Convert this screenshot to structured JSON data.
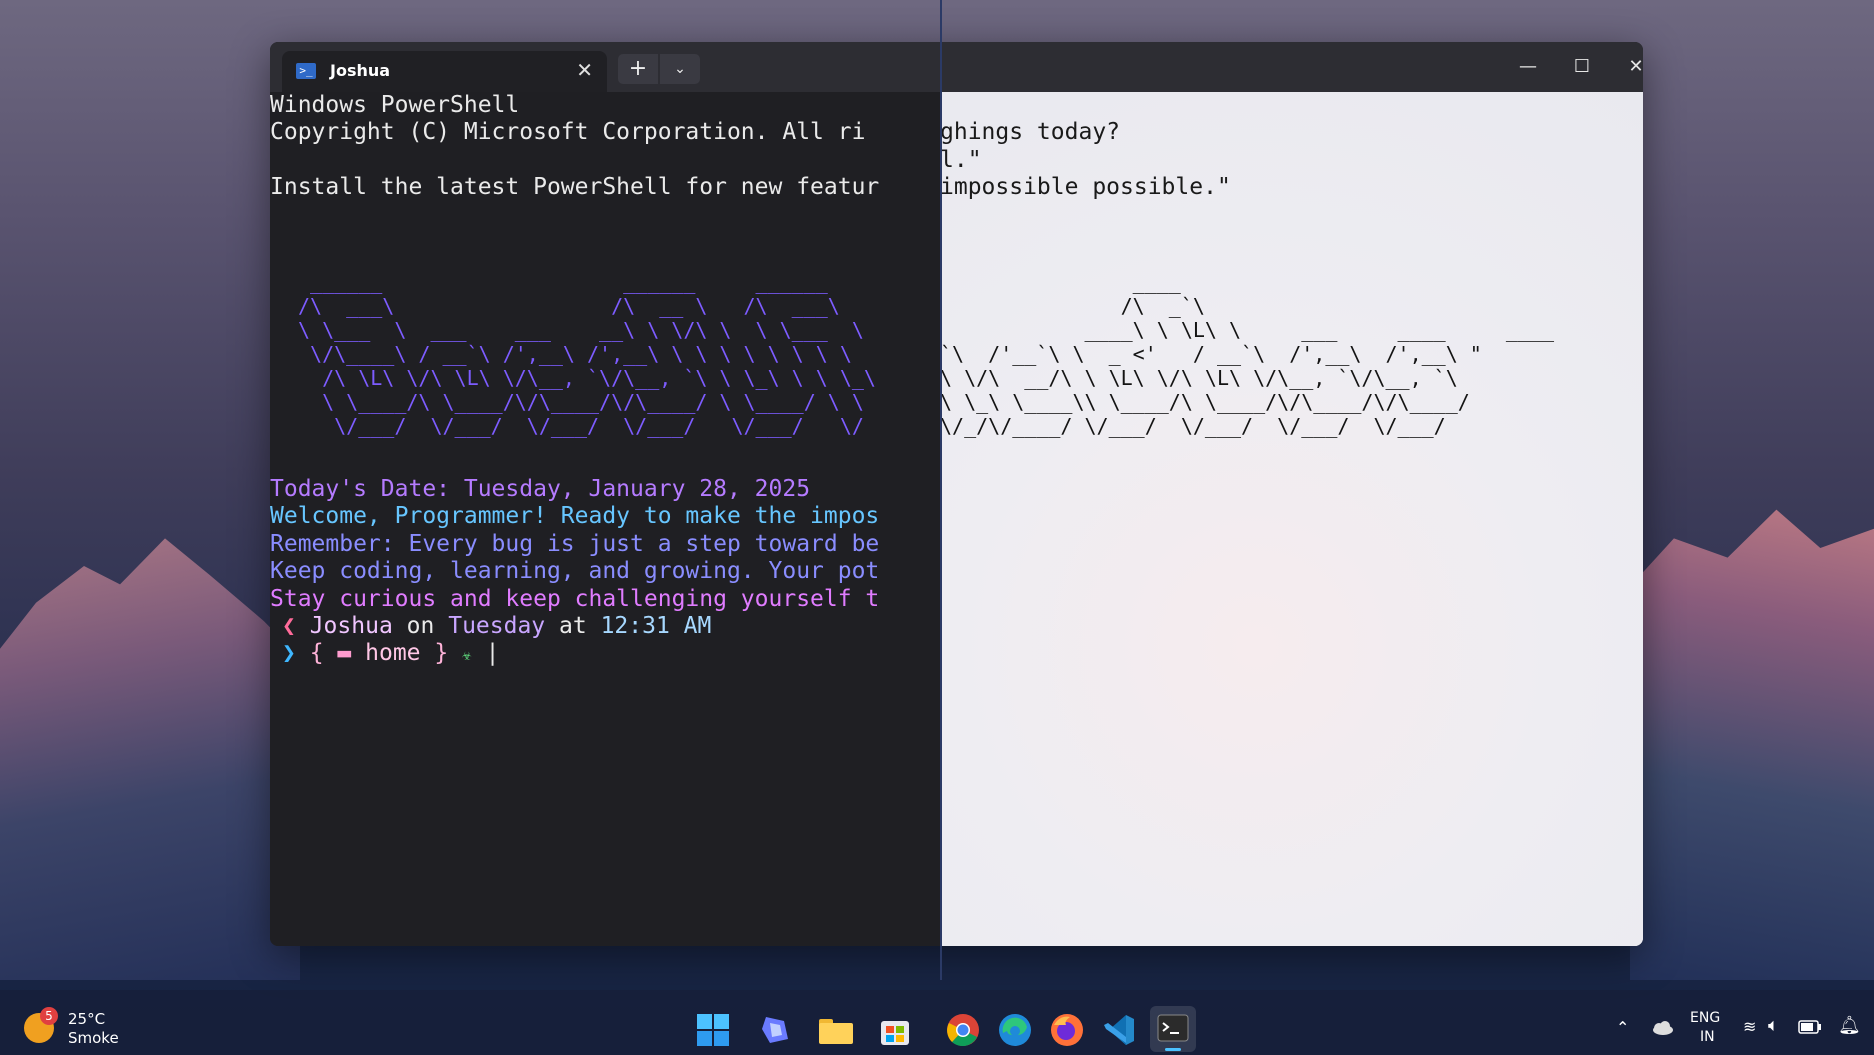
{
  "window": {
    "tab_title": "Joshua",
    "new_tab_symbol": "+",
    "dropdown_symbol": "⌄",
    "min_symbol": "—",
    "max_symbol": "☐",
    "close_symbol": "✕",
    "tab_close_symbol": "✕"
  },
  "terminal": {
    "dark": {
      "header": [
        "Windows PowerShell",
        "Copyright (C) Microsoft Corporation. All ri",
        "",
        "Install the latest PowerShell for new featur"
      ],
      "ascii_art": [
        " ______                    ______     ______",
        "/\\  ___\\                  /\\  __ \\   /\\  ___\\",
        "\\ \\___  \\  ___    ___    __\\ \\ \\/\\ \\  \\ \\___  \\",
        " \\/\\____\\ / __`\\ /',__\\ /',__\\ \\ \\ \\ \\ \\ \\ \\ \\",
        "  /\\ \\L\\ \\/\\ \\L\\ \\/\\__, `\\/\\__, `\\ \\ \\_\\ \\ \\ \\_\\",
        "  \\ \\____/\\ \\____/\\/\\____/\\/\\____/ \\ \\____/ \\ \\",
        "   \\/___/  \\/___/  \\/___/  \\/___/   \\/___/   \\/"
      ],
      "date_line": "Today's Date: Tuesday, January 28, 2025",
      "welcome_line": "Welcome, Programmer! Ready to make the impos",
      "remember_line": "Remember: Every bug is just a step toward be",
      "keep_line": "Keep coding, learning, and growing. Your pot",
      "stay_line": "Stay curious and keep challenging yourself t"
    },
    "light": {
      "header": [
        "",
        "ghings today?",
        "l.\"",
        "impossible possible.\""
      ],
      "ascii_art": [
        "                ____",
        "               /\\  _`\\",
        "            ____\\ \\ \\L\\ \\     ___     ____     ____",
        "`\\  /'__`\\ \\  _ <'   / __`\\  /',__\\  /',__\\ \"",
        "\\ \\/\\  __/\\ \\ \\L\\ \\/\\ \\L\\ \\/\\__, `\\/\\__, `\\",
        "\\ \\_\\ \\____\\\\ \\____/\\ \\____/\\/\\____/\\/\\____/",
        "\\/_/\\/____/ \\/___/  \\/___/  \\/___/  \\/___/"
      ]
    },
    "prompt": {
      "user": "Joshua",
      "on": "on",
      "day": "Tuesday",
      "at": "at",
      "time": "12:31 AM",
      "open_brace": "{",
      "folder": "home",
      "close_brace": "}"
    }
  },
  "taskbar": {
    "weather_count": "5",
    "temperature": "25°C",
    "condition": "Smoke",
    "language": "ENG",
    "region": "IN",
    "icons": [
      "start-icon",
      "copilot-icon",
      "file-explorer-icon",
      "store-icon",
      "chrome-icon",
      "edge-icon",
      "firefox-icon",
      "vscode-icon",
      "terminal-icon"
    ]
  }
}
